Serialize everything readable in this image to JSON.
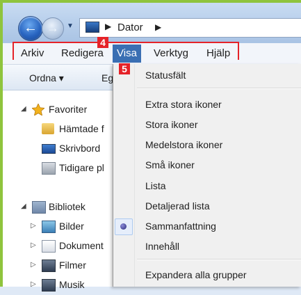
{
  "address": {
    "path": "Dator"
  },
  "menubar": {
    "items": [
      "Arkiv",
      "Redigera",
      "Visa",
      "Verktyg",
      "Hjälp"
    ],
    "active": "Visa"
  },
  "badges": [
    "4",
    "5"
  ],
  "toolbar": {
    "organize": "Ordna ▾",
    "partial": "Eg"
  },
  "navpane": {
    "favorites": {
      "label": "Favoriter",
      "children": [
        "Hämtade f",
        "Skrivbord",
        "Tidigare pl"
      ]
    },
    "library": {
      "label": "Bibliotek",
      "children": [
        "Bilder",
        "Dokument",
        "Filmer",
        "Musik"
      ]
    }
  },
  "view_menu": {
    "items": [
      "Statusfält",
      "Extra stora ikoner",
      "Stora ikoner",
      "Medelstora ikoner",
      "Små ikoner",
      "Lista",
      "Detaljerad lista",
      "Sammanfattning",
      "Innehåll",
      "Expandera alla grupper"
    ],
    "selected": "Sammanfattning"
  },
  "colors": {
    "highlight": "#e52228",
    "menu_active": "#3a6fb3",
    "frame": "#8fc43d"
  }
}
